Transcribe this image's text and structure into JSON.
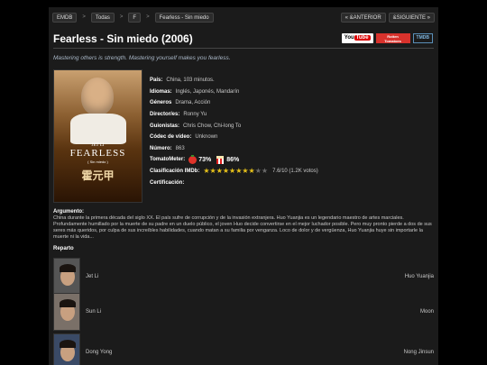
{
  "breadcrumb": {
    "items": [
      "EMDB",
      "Todas",
      "F",
      "Fearless - Sin miedo"
    ]
  },
  "nav": {
    "prev": "« &ANTERIOR",
    "next": "&SIGUIENTE »"
  },
  "movie": {
    "title": "Fearless - Sin miedo (2006)",
    "tagline": "Mastering others is strength. Mastering yourself makes you fearless.",
    "poster": {
      "actor": "JET LI",
      "title": "FEARLESS",
      "subtitle": "( Sin miedo )",
      "chinese_title": "霍元甲"
    },
    "logos": {
      "youtube": "You",
      "youtube_tube": "Tube",
      "rt_line1": "Rotten",
      "rt_line2": "Tomatoes",
      "tmdb": "TMDB"
    }
  },
  "details": {
    "pais": {
      "label": "País:",
      "value": "China, 103 minutos."
    },
    "idiomas": {
      "label": "Idiomas:",
      "value": "Inglés, Japonés, Mandarín"
    },
    "generos": {
      "label": "Géneros",
      "value": "Drama, Acción"
    },
    "directores": {
      "label": "Director/es:",
      "value": "Ronny Yu"
    },
    "guionistas": {
      "label": "Guionistas:",
      "value": "Chris Chow, Chi-long To"
    },
    "codec": {
      "label": "Códec de vídeo:",
      "value": "Unknown"
    },
    "numero": {
      "label": "Número:",
      "value": "863"
    },
    "tomatometer": {
      "label": "TomatoMeter:",
      "critics": "73%",
      "audience": "86%",
      "color_tomato": "#e0342a"
    },
    "imdb": {
      "label": "Clasificación IMDb:",
      "value": "7.6/10 (1.2K votos)",
      "stars_filled": 7.6,
      "stars_total": 10
    },
    "certificacion": {
      "label": "Certificación:",
      "value": ""
    }
  },
  "argumento": {
    "label": "Argumento:",
    "text": "China durante la primera década del siglo XX. El país sufre de corrupción y de la invasión extranjera. Huo Yuanjia es un legendario maestro de artes marciales. Profundamente humillado por la muerte de su padre en un duelo público, el joven Huo decide convertirse en el mejor luchador posible. Pero muy pronto pierde a dos de sus seres más queridos, por culpa de sus increíbles habilidades, cuando matan a su familia por venganza. Loco de dolor y de vergüenza, Huo Yuanjia huye sin importarle la muerte ni la vida..."
  },
  "reparto": {
    "label": "Reparto",
    "cast": [
      {
        "actor": "Jet Li",
        "role": "Huo Yuanjia"
      },
      {
        "actor": "Sun Li",
        "role": "Moon"
      },
      {
        "actor": "Dong Yong",
        "role": "Nong Jinsun"
      }
    ]
  }
}
